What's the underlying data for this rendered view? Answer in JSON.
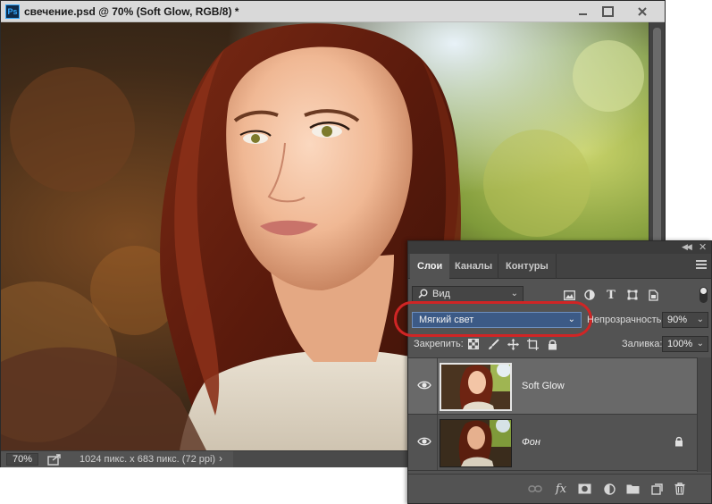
{
  "document": {
    "title": "свечение.psd @ 70% (Soft Glow, RGB/8) *",
    "app_icon": "ps-logo-icon",
    "app_icon_text": "Ps",
    "zoom": "70%",
    "size_info": "1024 пикс. x 683 пикс. (72 ppi)",
    "status_arrow": "›"
  },
  "layers_panel": {
    "tabs": [
      {
        "label": "Слои",
        "active": true
      },
      {
        "label": "Каналы",
        "active": false
      },
      {
        "label": "Контуры",
        "active": false
      }
    ],
    "filter_kind": "Вид",
    "blend_mode": "Мягкий свет",
    "opacity_label": "Непрозрачность:",
    "opacity_value": "90%",
    "lock_label": "Закрепить:",
    "fill_label": "Заливка:",
    "fill_value": "100%",
    "layers": [
      {
        "name": "Soft Glow",
        "visible": true,
        "selected": true,
        "locked": false
      },
      {
        "name": "Фон",
        "visible": true,
        "selected": false,
        "locked": true
      }
    ],
    "footer_icons": [
      "link-layers-icon",
      "fx-icon",
      "add-mask-icon",
      "adjustment-layer-icon",
      "new-group-icon",
      "new-layer-icon",
      "trash-icon"
    ],
    "fx_text": "fx"
  },
  "colors": {
    "panel_bg": "#535353",
    "selection_blue": "#3c5a86",
    "highlight_red": "#d02525"
  }
}
